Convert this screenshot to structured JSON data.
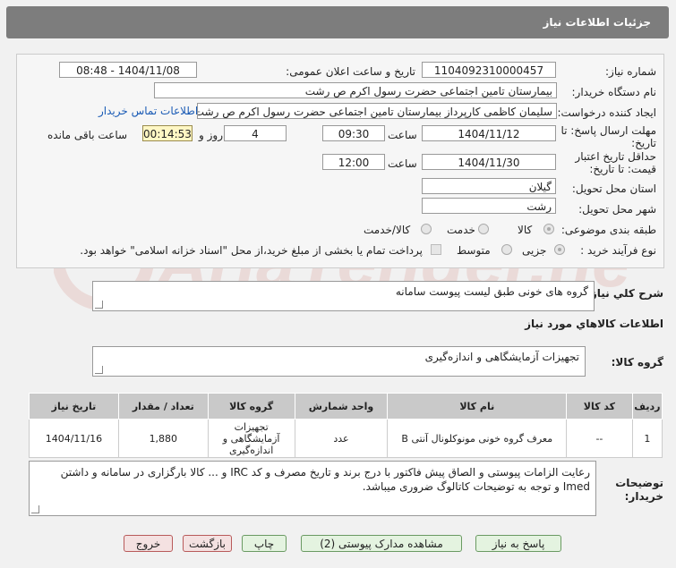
{
  "header": {
    "title": "جزئیات اطلاعات نیاز"
  },
  "form": {
    "need_number": {
      "label": "شماره نیاز:",
      "value": "1104092310000457"
    },
    "announce_datetime": {
      "label": "تاریخ و ساعت اعلان عمومی:",
      "value": "1404/11/08 - 08:48"
    },
    "buyer_org": {
      "label": "نام دستگاه خریدار:",
      "value": "بیمارستان  تامین اجتماعی حضرت رسول اکرم ص رشت"
    },
    "requester": {
      "label": "ایجاد کننده درخواست:",
      "value": "سلیمان کاظمی کارپرداز بیمارستان  تامین اجتماعی حضرت رسول اکرم ص رشت",
      "contact_link": "اطلاعات تماس خریدار"
    },
    "reply_deadline": {
      "label_line1": "مهلت ارسال پاسخ: تا",
      "label_line2": "تاریخ:",
      "date": "1404/11/12",
      "time_label": "ساعت",
      "time": "09:30",
      "days": "4",
      "days_label": "روز و",
      "remaining": "00:14:53",
      "remaining_label": "ساعت باقی مانده"
    },
    "price_validity": {
      "label_line1": "حداقل تاریخ اعتبار",
      "label_line2": "قیمت: تا تاریخ:",
      "date": "1404/11/30",
      "time_label": "ساعت",
      "time": "12:00"
    },
    "delivery_province": {
      "label": "استان محل تحویل:",
      "value": "گیلان"
    },
    "delivery_city": {
      "label": "شهر محل تحویل:",
      "value": "رشت"
    },
    "category": {
      "label": "طبقه بندی موضوعی:",
      "options": [
        "کالا",
        "خدمت",
        "کالا/خدمت"
      ],
      "selected": "کالا"
    },
    "purchase_process": {
      "label": "نوع فرآیند خرید :",
      "options": [
        "جزیی",
        "متوسط"
      ],
      "selected": "جزیی",
      "payment_note": "پرداخت تمام یا بخشی از مبلغ خرید،از محل \"اسناد خزانه اسلامی\" خواهد بود."
    }
  },
  "summary": {
    "label": "شرح کلي نياز:",
    "value": "گروه های خونی طبق لیست پیوست سامانه"
  },
  "goods_info": {
    "title": "اطلاعات کالاهاي مورد نياز"
  },
  "goods_group": {
    "label": "گروه کالا:",
    "value": "تجهیزات آزمایشگاهی و اندازه‌گیری"
  },
  "table": {
    "headers": [
      "ردیف",
      "کد کالا",
      "نام کالا",
      "واحد شمارش",
      "گروه کالا",
      "تعداد / مقدار",
      "تاریخ نیاز"
    ],
    "rows": [
      {
        "row": "1",
        "code": "--",
        "name": "معرف گروه خونی مونوکلونال آنتی B",
        "unit": "عدد",
        "group": "تجهیزات آزمایشگاهی و اندازه‌گیری",
        "qty": "1,880",
        "date": "1404/11/16"
      }
    ]
  },
  "buyer_notes": {
    "label_line1": "توضیحات",
    "label_line2": "خریدار:",
    "value": "رعایت الزامات پیوستی و الصاق پیش فاکتور با درج برند و تاریخ مصرف و کد IRC و ... کالا بارگزاری در سامانه و داشتن Imed و توجه به توضیحات کاتالوگ ضروری میباشد."
  },
  "buttons": {
    "reply": "پاسخ به نیاز",
    "view_docs": "مشاهده مدارک پیوستی (2)",
    "print": "چاپ",
    "back": "بازگشت",
    "exit": "خروج"
  },
  "watermark": {
    "text": "AriaTender.net"
  }
}
